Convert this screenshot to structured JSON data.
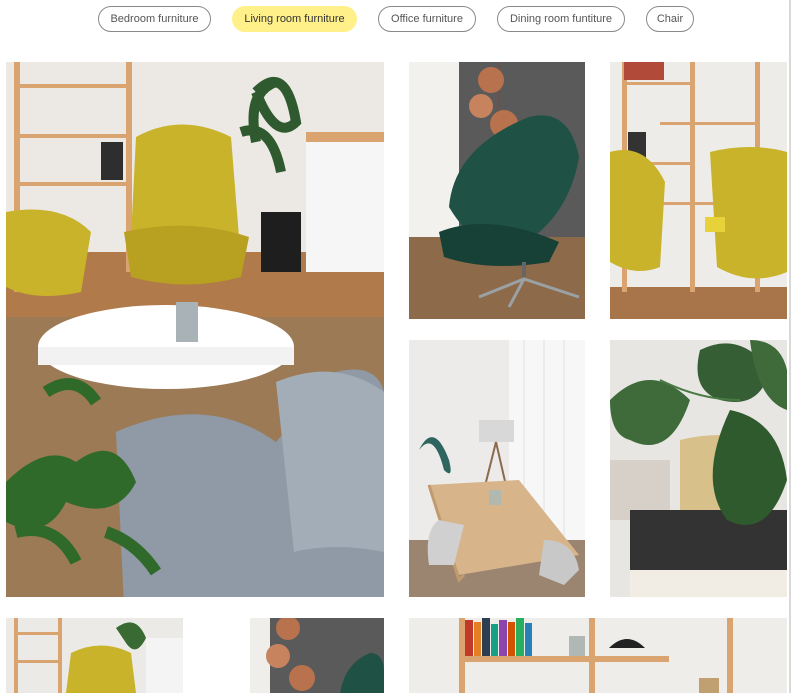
{
  "filters": [
    {
      "label": "Bedroom furniture",
      "active": false
    },
    {
      "label": "Living room furniture",
      "active": true
    },
    {
      "label": "Office furniture",
      "active": false
    },
    {
      "label": "Dining room funtiture",
      "active": false
    },
    {
      "label": "Chair",
      "active": false
    }
  ],
  "gallery": {
    "images": [
      {
        "subject": "living room with yellow armchairs, white coffee table and grey sofa"
      },
      {
        "subject": "green leather lounge chair with copper pendant lamps"
      },
      {
        "subject": "yellow armchairs in front of wooden shelf"
      },
      {
        "subject": "dining room with wooden table, grey chairs and floor lamp"
      },
      {
        "subject": "monstera plant in front of sofa"
      },
      {
        "subject": "yellow armchair and shelf"
      },
      {
        "subject": "copper pendant lamps and green chair"
      },
      {
        "subject": "wooden bookshelf with books and caps"
      }
    ]
  },
  "colors": {
    "active_filter": "#fff08a",
    "pill_border": "#8a8a8a"
  }
}
